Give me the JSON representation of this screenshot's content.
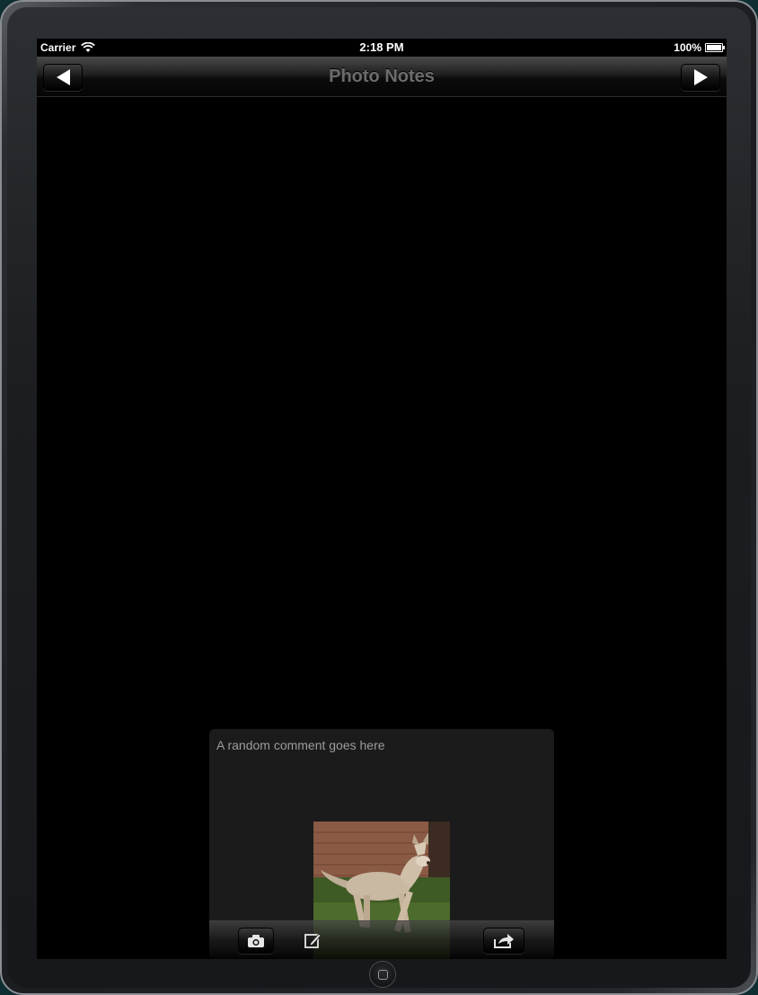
{
  "status_bar": {
    "carrier": "Carrier",
    "time": "2:18 PM",
    "battery": "100%"
  },
  "nav_bar": {
    "title": "Photo Notes",
    "back_icon": "left-arrow-icon",
    "forward_icon": "right-arrow-icon"
  },
  "note": {
    "comment": "A random comment goes here",
    "photo_icon": "dog-photo",
    "toolbar": {
      "camera_icon": "camera-icon",
      "edit_icon": "compose-icon",
      "share_icon": "share-icon"
    }
  },
  "colors": {
    "screen_bg": "#000000",
    "card_bg": "#1b1b1b",
    "title_text": "#6b6b6b",
    "comment_text": "#9c9c9c"
  }
}
